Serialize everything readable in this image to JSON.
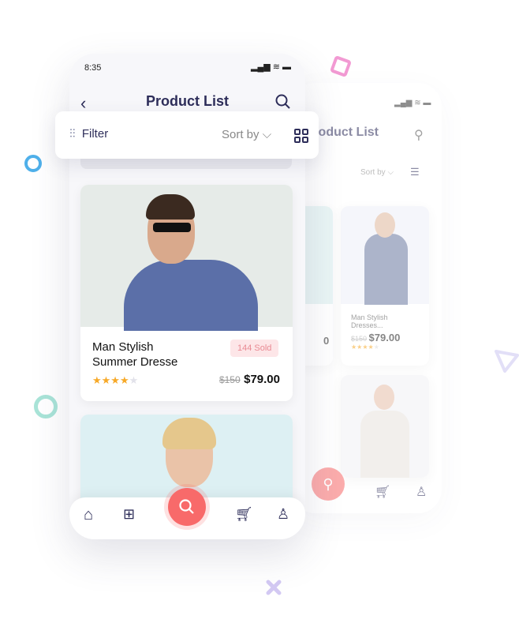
{
  "status": {
    "time": "8:35"
  },
  "header": {
    "title": "Product List",
    "back_title": "Product List"
  },
  "filter": {
    "label": "Filter",
    "sort_label": "Sort by"
  },
  "product": {
    "name_line1": "Man Stylish",
    "name_line2": "Summer Dresse",
    "badge": "144 Sold",
    "old_price": "$150",
    "price": "$79.00",
    "rating": 4,
    "max_rating": 5
  },
  "back_screen": {
    "sort_label": "Sort by",
    "item": {
      "name_line1": "Man Stylish",
      "name_line2": "Dresses...",
      "old_price": "$150",
      "price": "$79.00",
      "rating": 4
    },
    "partial_price": "0"
  },
  "colors": {
    "accent": "#f86a6a",
    "title": "#2e2e5a",
    "star": "#f7a928",
    "badge_bg": "#fde6e8",
    "badge_text": "#e98a93"
  }
}
